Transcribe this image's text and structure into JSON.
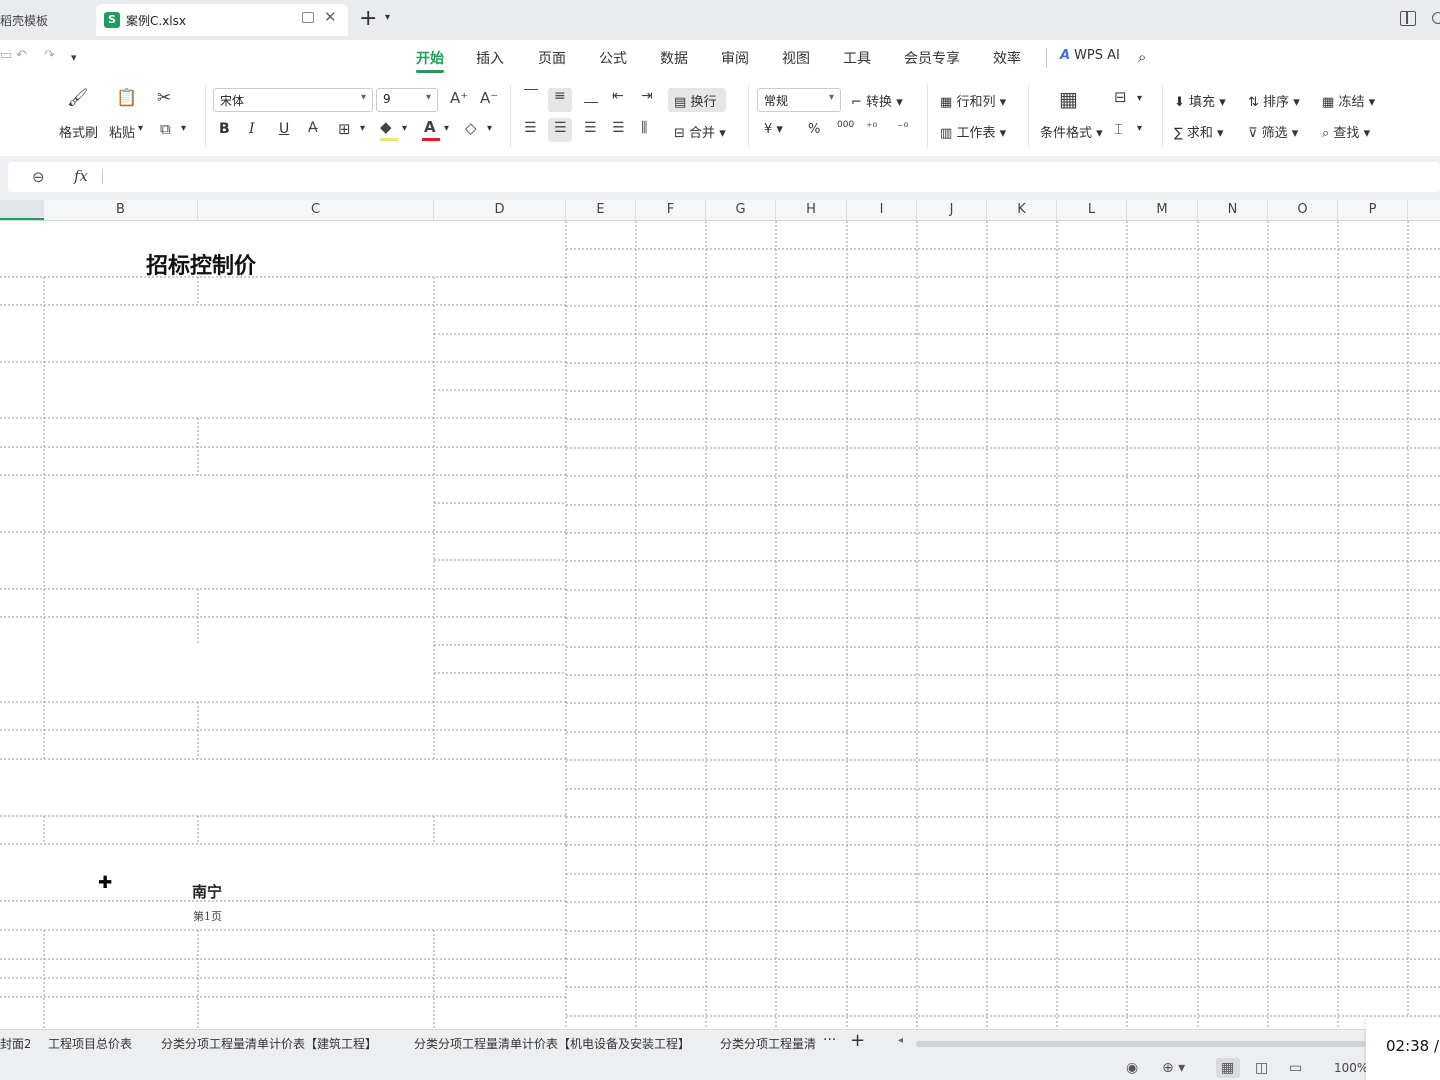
{
  "window": {
    "tabs": [
      {
        "label": "稻壳模板",
        "active": false
      },
      {
        "label": "案例C.xlsx",
        "active": true,
        "icon": "S"
      }
    ]
  },
  "menu": {
    "items": [
      "开始",
      "插入",
      "页面",
      "公式",
      "数据",
      "审阅",
      "视图",
      "工具",
      "会员专享",
      "效率"
    ],
    "active": "开始",
    "wps_ai": "WPS AI"
  },
  "ribbon": {
    "format_painter": "格式刷",
    "paste": "粘贴",
    "font_name": "宋体",
    "font_size": "9",
    "bold": "B",
    "italic": "I",
    "underline": "U",
    "wrap": "换行",
    "merge": "合并",
    "number_format": "常规",
    "convert": "转换",
    "rows_cols": "行和列",
    "worksheet": "工作表",
    "cond_format": "条件格式",
    "fill": "填充",
    "sort": "排序",
    "freeze": "冻结",
    "sum": "求和",
    "filter": "筛选",
    "find": "查找",
    "currency": "¥",
    "percent": "%",
    "thousands": "000",
    "fill_color": "#f6e27a",
    "font_color": "#e02020",
    "accent": "#1e9e5a"
  },
  "formula_bar": {
    "fx": "fx",
    "content": ""
  },
  "columns": [
    "B",
    "C",
    "D",
    "E",
    "F",
    "G",
    "H",
    "I",
    "J",
    "K",
    "L",
    "M",
    "N",
    "O",
    "P"
  ],
  "sheet": {
    "title": "招标控制价",
    "city": "南宁",
    "page": "第1页"
  },
  "sheet_tabs": [
    "封面2",
    "工程项目总价表",
    "分类分项工程量清单计价表【建筑工程】",
    "分类分项工程量清单计价表【机电设备及安装工程】",
    "分类分项工程量清"
  ],
  "status": {
    "zoom": "100%",
    "time": "02:38 /"
  }
}
